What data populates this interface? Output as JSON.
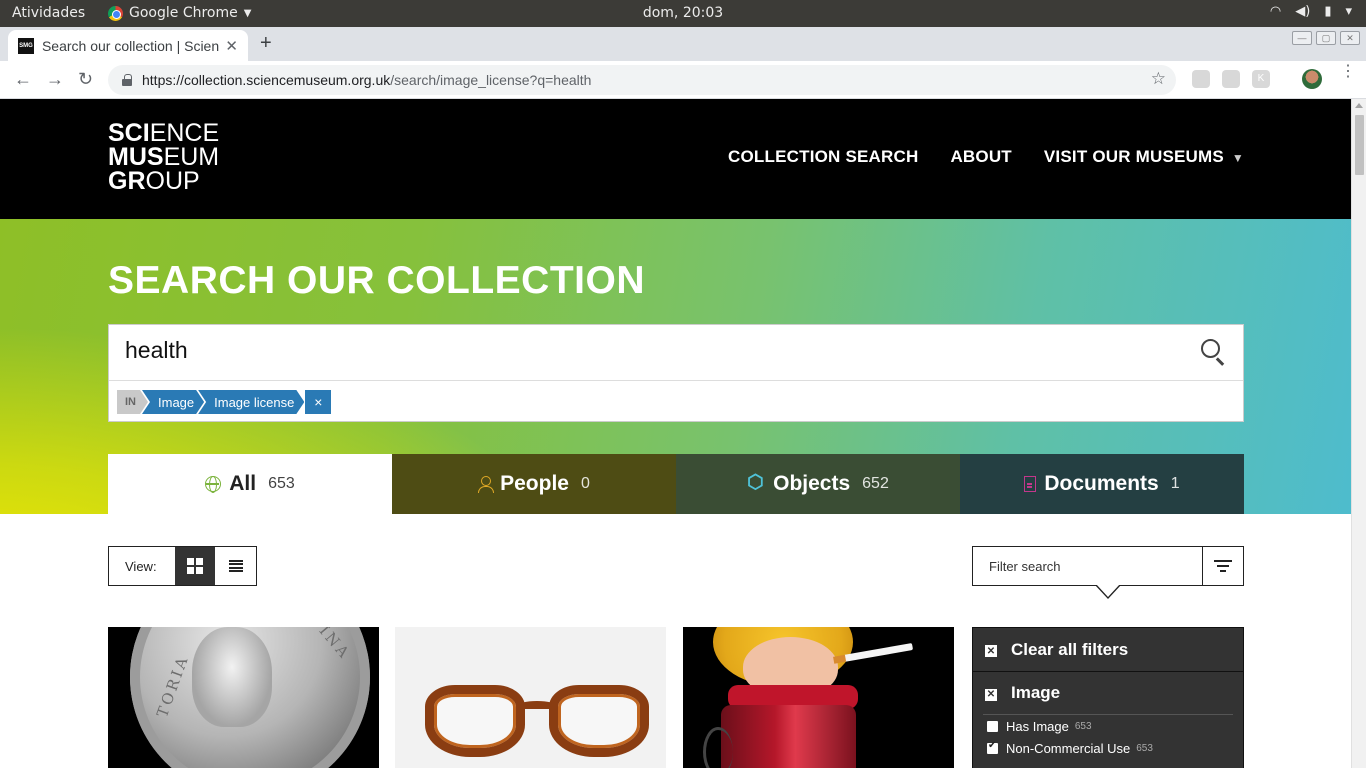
{
  "os_bar": {
    "activities": "Atividades",
    "app_name": "Google Chrome",
    "clock": "dom, 20:03"
  },
  "browser": {
    "tab_title": "Search our collection | Science",
    "favicon_text": "SMG",
    "url_host": "https://collection.sciencemuseum.org.uk",
    "url_path": "/search/image_license?q=health"
  },
  "site": {
    "logo": {
      "line1_bold": "SCI",
      "line1_light": "ENCE",
      "line2_bold": "MUS",
      "line2_light": "EUM",
      "line3_bold": "GR",
      "line3_light": "OUP"
    },
    "nav": {
      "collection_search": "COLLECTION SEARCH",
      "about": "ABOUT",
      "visit": "VISIT OUR MUSEUMS"
    }
  },
  "hero": {
    "title": "SEARCH OUR COLLECTION",
    "query": "health",
    "chip_in": "IN",
    "chips": [
      "Image",
      "Image license"
    ],
    "chip_clear": "×"
  },
  "tabs": [
    {
      "label": "All",
      "count": "653"
    },
    {
      "label": "People",
      "count": "0"
    },
    {
      "label": "Objects",
      "count": "652"
    },
    {
      "label": "Documents",
      "count": "1"
    }
  ],
  "results": {
    "view_label": "View:",
    "filter_placeholder": "Filter search",
    "medal_text_left": "TORIA",
    "medal_text_right": "REGINA"
  },
  "filters": {
    "clear_all": "Clear all filters",
    "group_image": "Image",
    "options": [
      {
        "label": "Has Image",
        "count": "653",
        "checked": false
      },
      {
        "label": "Non-Commercial Use",
        "count": "653",
        "checked": true
      }
    ]
  },
  "colors": {
    "brand_black": "#000000",
    "chip_blue": "#2a7ab5",
    "hero_green": "#86c13c",
    "hero_yellow": "#f5ea00",
    "hero_teal": "#4ebccd"
  }
}
